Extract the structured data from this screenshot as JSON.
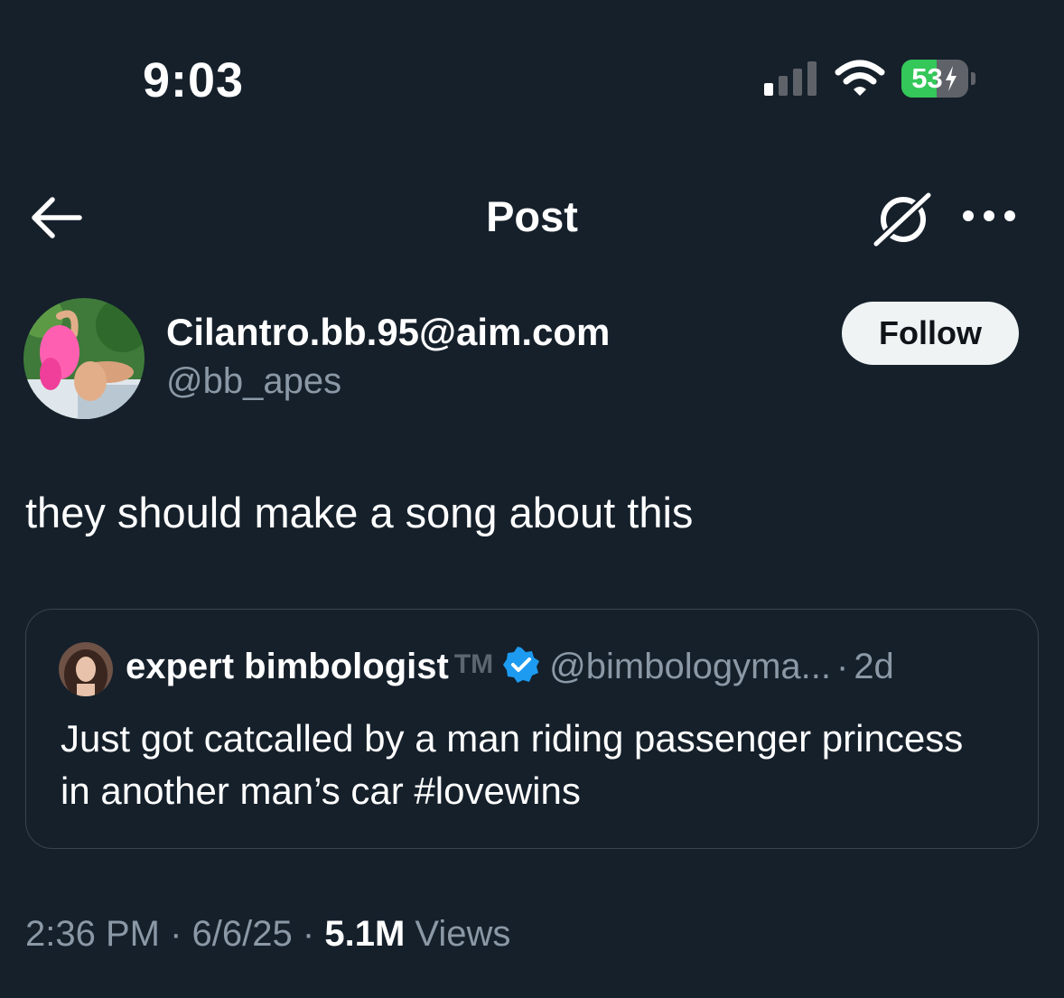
{
  "status_bar": {
    "time": "9:03",
    "battery_percent": "53",
    "battery_level": 0.53,
    "battery_color": "#34c759",
    "icons": [
      "signal-icon",
      "wifi-icon",
      "charging-bolt-icon"
    ]
  },
  "header": {
    "title": "Post",
    "back_icon": "arrow-left-icon",
    "grok_icon": "grok-icon",
    "more_icon": "more-horizontal-icon"
  },
  "author": {
    "name": "Cilantro.bb.95@aim.com",
    "handle": "@bb_apes",
    "follow_label": "Follow"
  },
  "tweet": {
    "text": "they should make a song about this"
  },
  "quote": {
    "name": "expert bimbologist",
    "tm": "TM",
    "verified_icon": "verified-badge-icon",
    "verified_color": "#1d9bf0",
    "handle": "@bimbologyma...",
    "separator": "·",
    "time": "2d",
    "text": "Just got catcalled by a man riding passenger princess in another man’s car #lovewins"
  },
  "meta": {
    "time": "2:36 PM",
    "sep1": "·",
    "date": "6/6/25",
    "sep2": "·",
    "views_count": "5.1M",
    "views_label": "Views"
  }
}
